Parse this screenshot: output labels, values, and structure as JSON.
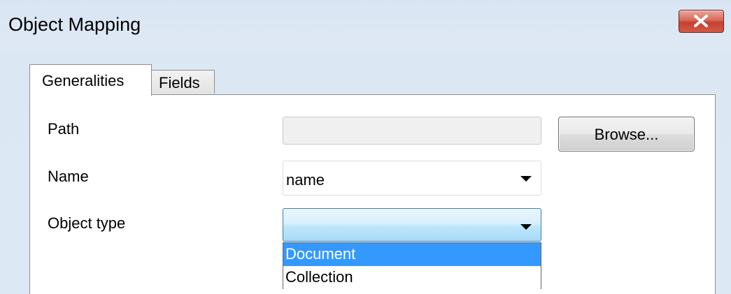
{
  "window": {
    "title": "Object Mapping",
    "close_icon": "close-icon",
    "close_button_color": "#c7402f"
  },
  "tabs": [
    {
      "label": "Generalities",
      "selected": true
    },
    {
      "label": "Fields",
      "selected": false
    }
  ],
  "form": {
    "path": {
      "label": "Path",
      "value": "",
      "browse_label": "Browse..."
    },
    "name": {
      "label": "Name",
      "value": "name"
    },
    "object_type": {
      "label": "Object type",
      "value": "",
      "options": [
        {
          "label": "Document",
          "highlighted": true
        },
        {
          "label": "Collection",
          "highlighted": false
        }
      ],
      "highlight_color": "#3399ff"
    }
  }
}
